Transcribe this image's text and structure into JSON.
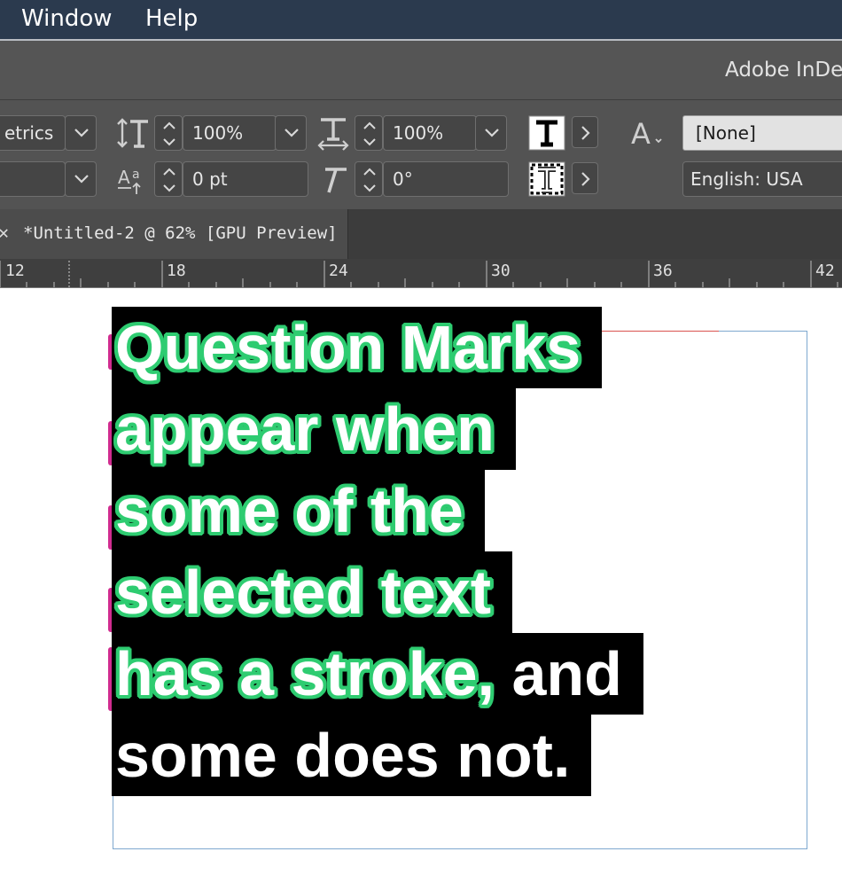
{
  "menubar": {
    "items": [
      "Window",
      "Help"
    ]
  },
  "app": {
    "title": "Adobe InDe"
  },
  "control": {
    "kerning_value": "etrics",
    "vertical_scale": "100%",
    "horizontal_scale": "100%",
    "baseline_shift": "0 pt",
    "skew": "0°",
    "char_style": "[None]",
    "language": "English: USA"
  },
  "document": {
    "tab_title": "*Untitled-2 @ 62% [GPU Preview]"
  },
  "ruler": {
    "labels": [
      "12",
      "18",
      "24",
      "30",
      "36",
      "42"
    ]
  },
  "canvas": {
    "lines": [
      {
        "stroked": "Question Marks",
        "plain": ""
      },
      {
        "stroked": "appear when",
        "plain": ""
      },
      {
        "stroked": "some of the",
        "plain": ""
      },
      {
        "stroked": "selected text",
        "plain": ""
      },
      {
        "stroked": "has a stroke,",
        "plain": " and"
      },
      {
        "stroked": "",
        "plain": "some does not."
      }
    ]
  },
  "colors": {
    "stroke": "#2ecc71",
    "menubar": "#2b3a4e",
    "text_bg": "#000000"
  },
  "icons": [
    "vertical-scale-icon",
    "horizontal-scale-icon",
    "baseline-shift-icon",
    "skew-icon",
    "fill-type-icon",
    "stroke-type-icon",
    "char-style-icon",
    "close-icon",
    "chevron-down-icon",
    "chevron-right-icon"
  ]
}
